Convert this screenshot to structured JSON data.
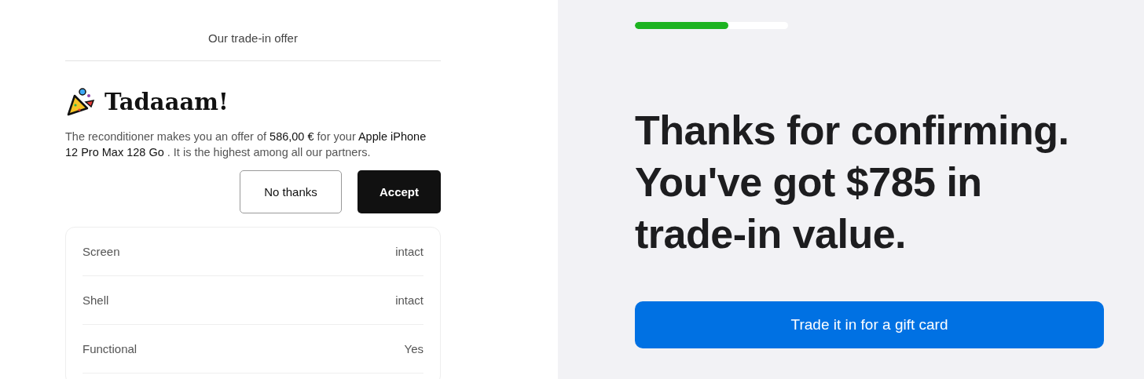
{
  "offer": {
    "header": "Our trade-in offer",
    "title": "Tadaaam!",
    "message": "The reconditioner makes you an offer of **586,00 €** for your **Apple iPhone 12 Pro Max 128 Go** . It is the highest among all our partners.",
    "buttons": [
      {
        "label": "No thanks",
        "kind": "secondary"
      },
      {
        "label": "Accept",
        "kind": "primary"
      }
    ],
    "conditions": [
      {
        "label": "Screen",
        "value": "intact"
      },
      {
        "label": "Shell",
        "value": "intact"
      },
      {
        "label": "Functional",
        "value": "Yes"
      }
    ]
  },
  "confirmation": {
    "progress": {
      "level": 0.61
    },
    "headline": "Thanks for confirming. You've got $785 in trade-in value.",
    "button": "Trade it in for a gift card"
  }
}
